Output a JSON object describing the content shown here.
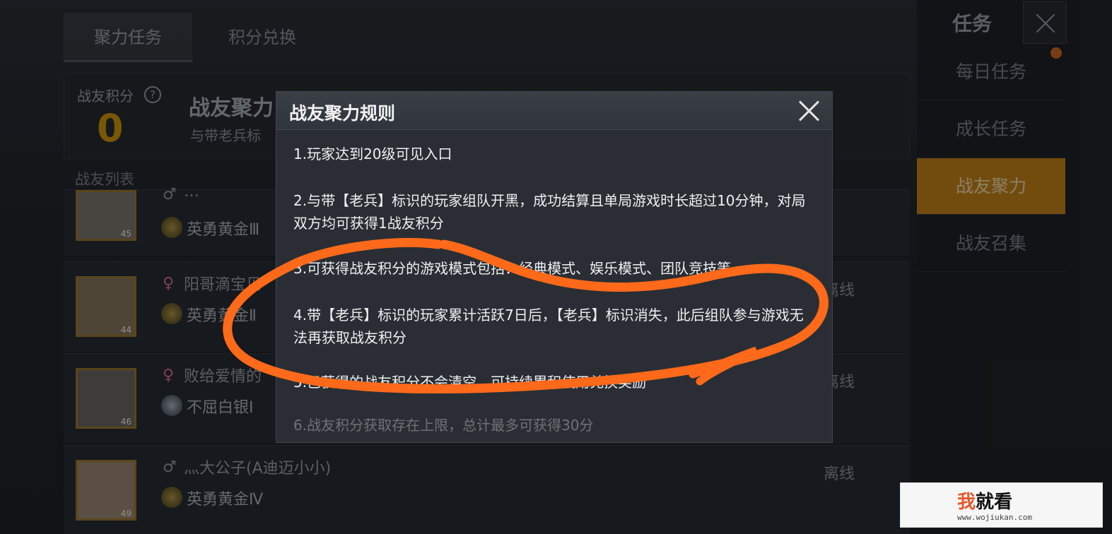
{
  "tabs": [
    {
      "label": "聚力任务",
      "active": true
    },
    {
      "label": "积分兑换",
      "active": false
    }
  ],
  "score": {
    "label": "战友积分",
    "help_glyph": "?",
    "value": "0"
  },
  "feature": {
    "title": "战友聚力",
    "subtitle": "与带老兵标"
  },
  "friend_list": {
    "header": "战友列表",
    "rows": [
      {
        "gender": "♂",
        "name": "…",
        "rank": "英勇黄金Ⅲ",
        "status": "",
        "level": "45"
      },
      {
        "gender": "♀",
        "name": "阳哥滴宝贝",
        "rank": "英勇黄金Ⅱ",
        "status": "离线",
        "level": "44"
      },
      {
        "gender": "♀",
        "name": "败给爱情的",
        "rank": "不屈白银Ⅰ",
        "status": "离线",
        "level": "46"
      },
      {
        "gender": "♂",
        "name": "灬大公子(A迪迈小小)",
        "rank": "英勇黄金Ⅳ",
        "status": "离线",
        "level": "49"
      }
    ]
  },
  "sidebar": {
    "title": "任务",
    "items": [
      {
        "label": "每日任务"
      },
      {
        "label": "成长任务"
      },
      {
        "label": "战友聚力",
        "active": true
      },
      {
        "label": "战友召集"
      }
    ]
  },
  "modal": {
    "title": "战友聚力规则",
    "rules": [
      "1.玩家达到20级可见入口",
      "2.与带【老兵】标识的玩家组队开黑，成功结算且单局游戏时长超过10分钟，对局双方均可获得1战友积分",
      "3.可获得战友积分的游戏模式包括：经典模式、娱乐模式、团队竞技等",
      "4.带【老兵】标识的玩家累计活跃7日后，【老兵】标识消失，此后组队参与游戏无法再获取战友积分",
      "5.已获得的战友积分不会清空，可持续累积使用兑换奖励",
      "6.战友积分获取存在上限，总计最多可获得30分"
    ]
  },
  "colors": {
    "accent": "#b07617",
    "annotation": "#ff6a1a",
    "score": "#b9860c"
  },
  "watermark": {
    "brand_prefix": "我",
    "brand_rest": "就看",
    "url": "www.wojiukan.com"
  }
}
